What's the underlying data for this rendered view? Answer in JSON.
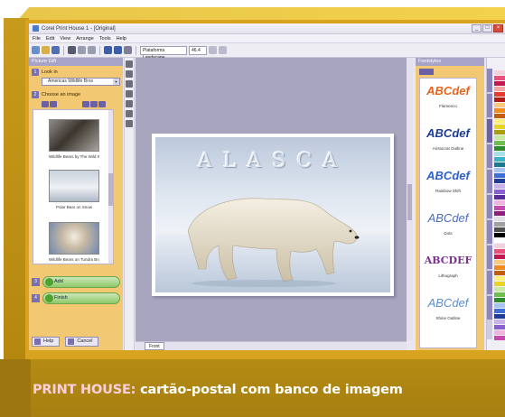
{
  "caption": {
    "lead": "PRINT HOUSE:",
    "text": " cartão-postal com banco de imagem"
  },
  "window": {
    "title": "Corel Print House 1 - [Original]"
  },
  "menu": [
    "File",
    "Edit",
    "View",
    "Arrange",
    "Tools",
    "Help"
  ],
  "toolbar": {
    "template_combo": "Plataforma Landscape",
    "zoom_combo": "46.4"
  },
  "left_panel": {
    "header": "Picture Gift",
    "step1_label": "Look in",
    "look_in_value": "Americas Wildlife Bros",
    "step2_label": "Choose an image",
    "thumbnails": [
      "Wildlife Bears by The Wild Wildlife",
      "Polar Bear on Snow",
      "Wildlife Bears on Tundra Brothers"
    ],
    "add_button": "Add",
    "step4_label": "Finish",
    "help_button": "Help",
    "cancel_button": "Cancel"
  },
  "canvas": {
    "card_title": "ALASCA",
    "page_tab": "Front"
  },
  "fonts_panel": {
    "header": "Fontstyles",
    "items": [
      {
        "sample": "ABCdef",
        "name": "Flamenco",
        "color": "#e8641a"
      },
      {
        "sample": "ABCdef",
        "name": "Aristocrat Outline",
        "color": "#1b3d9a"
      },
      {
        "sample": "ABCdef",
        "name": "Rainbow Shift",
        "color": "#2b5fd0"
      },
      {
        "sample": "ABCdef",
        "name": "Dots",
        "color": "#4a6bc4"
      },
      {
        "sample": "ABCDEF",
        "name": "Lithograph",
        "color": "#7a2f8f"
      },
      {
        "sample": "ABCdef",
        "name": "Shine Outline",
        "color": "#5a8fd0"
      }
    ]
  },
  "palette": {
    "colors": [
      "#f4d0dc",
      "#e94f7a",
      "#c2184f",
      "#f7a6a6",
      "#e63a2e",
      "#b01c15",
      "#f9c97c",
      "#f08b1c",
      "#c45e0a",
      "#fff27a",
      "#e8d422",
      "#a89e10",
      "#c6eaa0",
      "#6ec04c",
      "#2f8a2a",
      "#a7e0e6",
      "#3bb3c6",
      "#1b7a8f",
      "#a8c4f0",
      "#3d6fd6",
      "#1f3e9a",
      "#c8b4ea",
      "#8a5fd0",
      "#582d9a",
      "#f0b4e0",
      "#c84ab0",
      "#8e1e7e",
      "#e0e0e0",
      "#a0a0a0",
      "#505050",
      "#000000",
      "#ffffff",
      "#f4d0dc",
      "#e94f7a",
      "#c2184f",
      "#f9c97c",
      "#f08b1c",
      "#c45e0a",
      "#fff27a",
      "#e8d422",
      "#c6eaa0",
      "#6ec04c",
      "#2f8a2a",
      "#a8c4f0",
      "#3d6fd6",
      "#1f3e9a",
      "#c8b4ea",
      "#8a5fd0",
      "#f0b4e0",
      "#c84ab0"
    ]
  },
  "colors": {
    "frame_gold": "#d8a41f",
    "caption_bar": "#a67f10",
    "panel_bg": "#f2c873",
    "canvas_bg": "#a8a6bf"
  }
}
